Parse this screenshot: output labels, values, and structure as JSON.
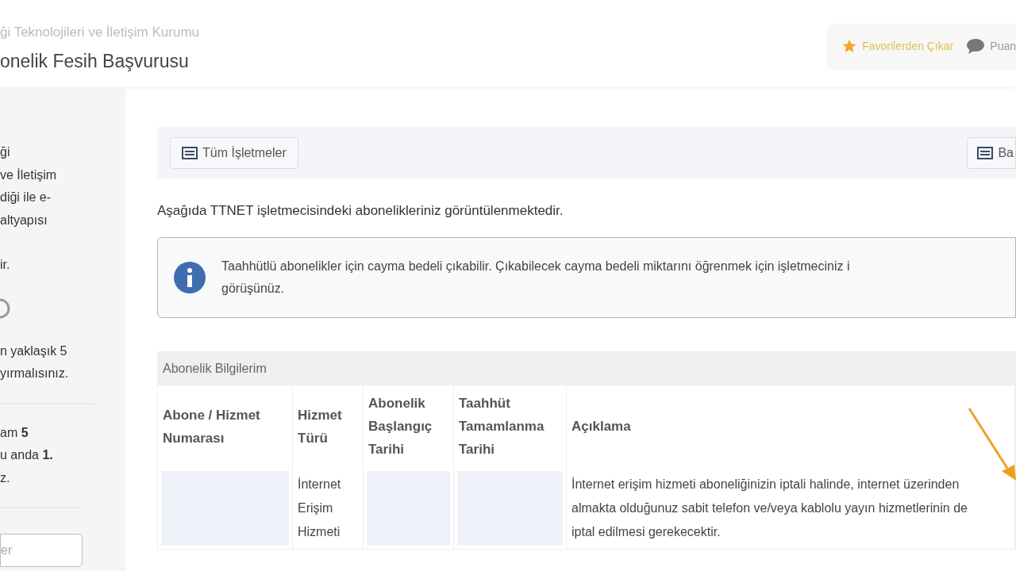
{
  "header": {
    "subtitle": "ği Teknolojileri ve İletişim Kurumu",
    "title": "onelik Fesih Başvurusu",
    "actions": [
      {
        "kind": "favorite",
        "label": "Favorilerden Çıkar"
      },
      {
        "kind": "rate",
        "label": "Puan"
      }
    ]
  },
  "sidebar": {
    "paragraphs": [
      [
        "ği",
        "ve İletişim",
        "diği ile e-",
        "altyapısı"
      ],
      [
        "ir."
      ],
      [
        "n yaklaşık 5",
        "yırmalısınız."
      ],
      [
        "am **5**",
        "u anda **1.**",
        "z."
      ]
    ],
    "input": {
      "value": "er"
    }
  },
  "toolbar": {
    "buttons": [
      {
        "label": "Tüm İşletmeler"
      },
      {
        "label": "Ba"
      }
    ]
  },
  "intro": "Aşağıda TTNET işletmecisindeki abonelikleriniz görüntülenmektedir.",
  "info": "Taahhütlü abonelikler için cayma bedeli çıkabilir. Çıkabilecek cayma bedeli miktarını öğrenmek için işletmeciniz i görüşünüz.",
  "table": {
    "title": "Abonelik Bilgilerim",
    "columns": [
      "Abone / Hizmet Numarası",
      "Hizmet Türü",
      "Abonelik Başlangıç Tarihi",
      "Taahhüt Tamamlanma Tarihi",
      "Açıklama"
    ],
    "rows": [
      {
        "cells": [
          {
            "kind": "redacted"
          },
          {
            "kind": "text",
            "text": "İnternet Erişim Hizmeti"
          },
          {
            "kind": "redacted"
          },
          {
            "kind": "redacted"
          },
          {
            "kind": "text",
            "text": "İnternet erişim hizmeti aboneliğinizin iptali halinde, internet üzerinden almakta olduğunuz sabit telefon ve/veya kablolu yayın hizmetlerinin de iptal edilmesi gerekecektir."
          }
        ]
      }
    ]
  }
}
